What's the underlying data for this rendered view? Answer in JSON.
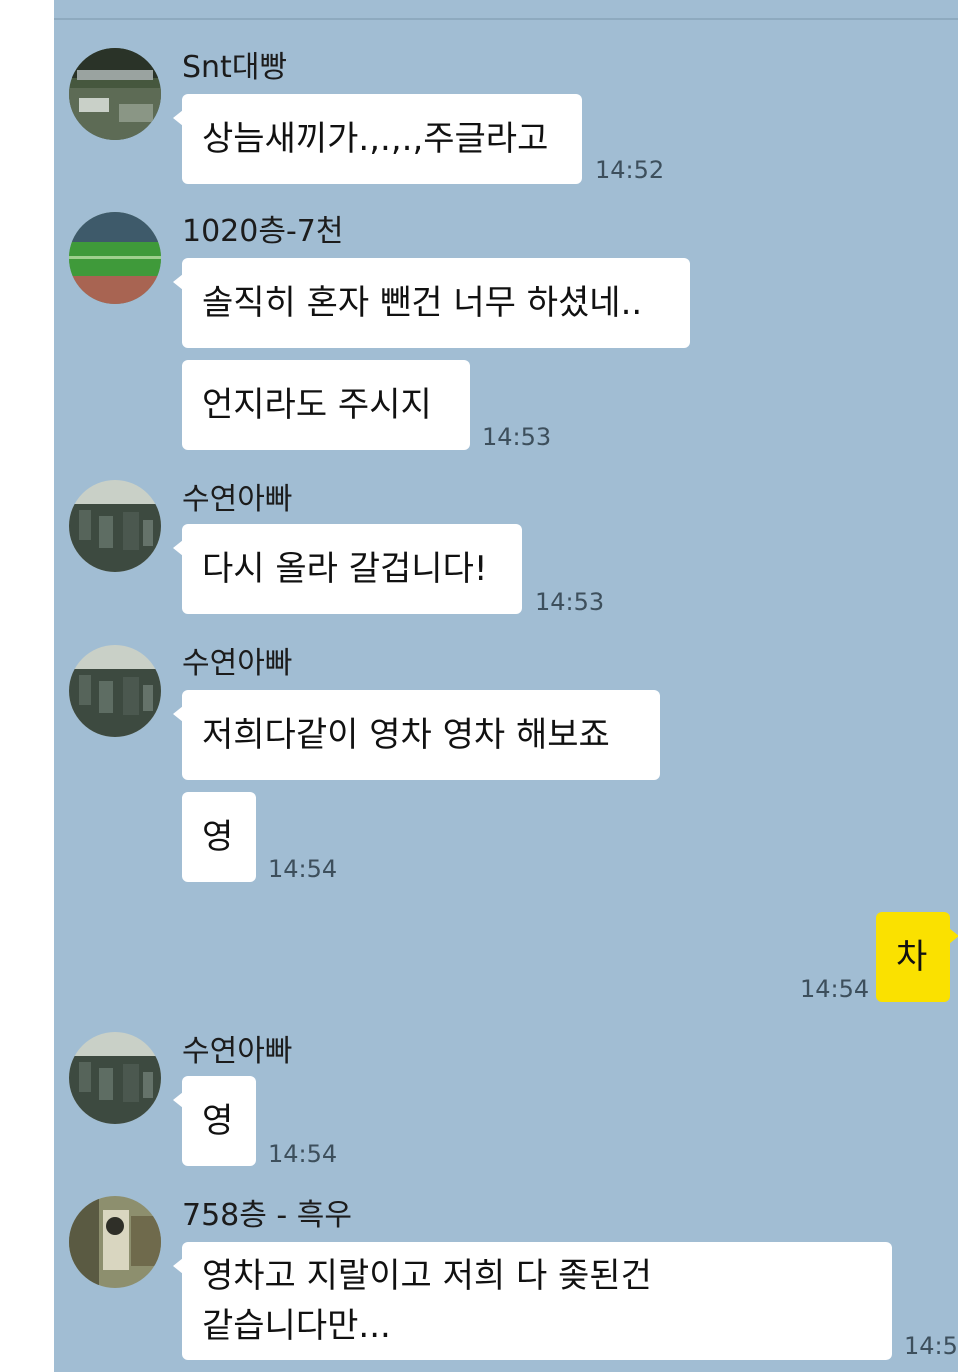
{
  "messages": [
    {
      "sender": "Snt대빵",
      "text": "상늠새끼가.,.,.,주글라고",
      "time": "14:52",
      "avatar": "stadium-night-avatar"
    },
    {
      "sender": "1020층-7천",
      "text": "솔직히 혼자 뺀건 너무 하셨네..",
      "avatar": "football-pitch-avatar"
    },
    {
      "text": "언지라도 주시지",
      "time": "14:53"
    },
    {
      "sender": "수연아빠",
      "text": "다시 올라 갈겁니다!",
      "time": "14:53",
      "avatar": "city-view-avatar"
    },
    {
      "sender": "수연아빠",
      "text": "저희다같이 영차 영차 해보죠",
      "avatar": "city-view-avatar"
    },
    {
      "text": "영",
      "time": "14:54"
    },
    {
      "text": "차",
      "time": "14:54",
      "mine": true
    },
    {
      "sender": "수연아빠",
      "text": "영",
      "time": "14:54",
      "avatar": "city-view-avatar"
    },
    {
      "sender": "758층 - 흑우",
      "text_lines": [
        "영차고 지랄이고 저희 다 좆된건",
        "같습니다만..."
      ],
      "time": "14:5",
      "avatar": "room-photo-avatar"
    }
  ],
  "colors": {
    "chat_background": "#a1bdd3",
    "incoming_bubble": "#ffffff",
    "outgoing_bubble": "#fae100",
    "time_text": "#3d4f5c"
  }
}
